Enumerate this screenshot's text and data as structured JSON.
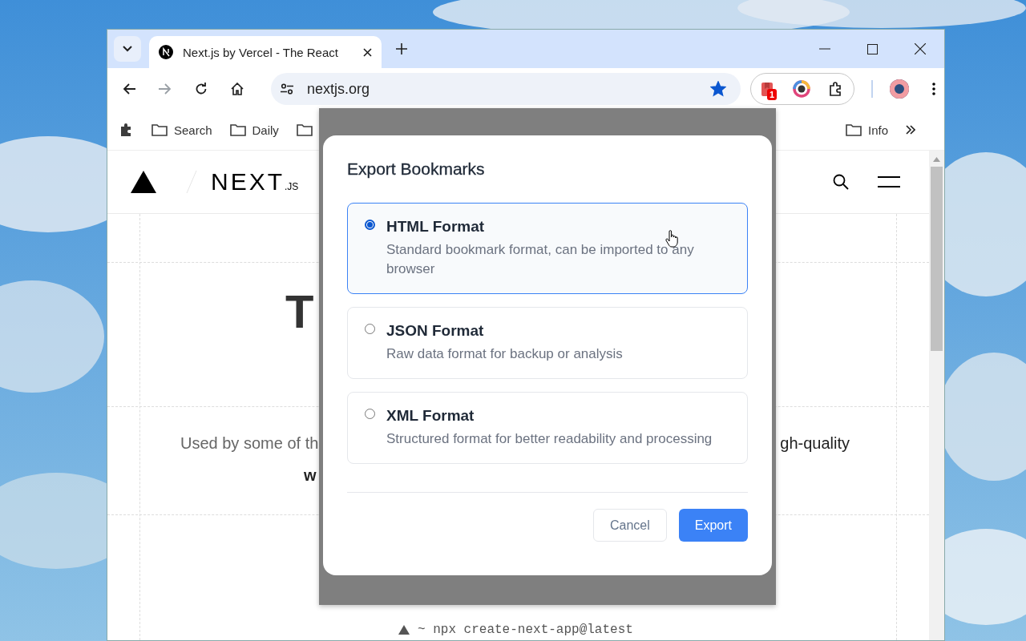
{
  "browser": {
    "tabs": [
      {
        "title": "Next.js by Vercel - The React",
        "selected": true
      }
    ],
    "address": "nextjs.org",
    "bookmarked": true,
    "extension_badge": "1",
    "bookmarks_left": [
      {
        "label": "Search"
      },
      {
        "label": "Daily"
      }
    ],
    "bookmarks_right": [
      {
        "label": "Info"
      }
    ]
  },
  "page": {
    "logo": {
      "wordmark": "NEXT",
      "suffix": ".JS"
    },
    "heading_fragment": "T",
    "tagline_left": "Used by some of th",
    "tagline_right": "gh-quality",
    "tagline_second_line": "w",
    "command": "~ npx create-next-app@latest"
  },
  "dialog": {
    "title": "Export Bookmarks",
    "options": [
      {
        "label": "HTML Format",
        "description": "Standard bookmark format, can be imported to any browser",
        "selected": true
      },
      {
        "label": "JSON Format",
        "description": "Raw data format for backup or analysis",
        "selected": false
      },
      {
        "label": "XML Format",
        "description": "Structured format for better readability and processing",
        "selected": false
      }
    ],
    "cancel": "Cancel",
    "confirm": "Export"
  }
}
